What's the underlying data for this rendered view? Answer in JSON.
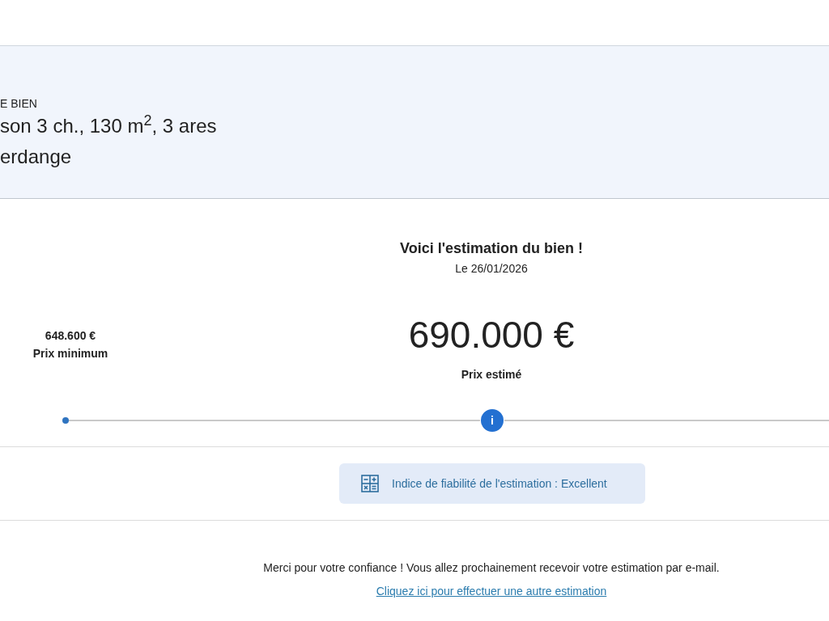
{
  "property": {
    "label": "E BIEN",
    "description": "son 3 ch., 130 m$^{2}$, 3 ares",
    "location": "erdange"
  },
  "estimate": {
    "title": "Voici l'estimation du bien !",
    "date": "Le 26/01/2026",
    "price": "690.000 €",
    "price_label": "Prix estimé",
    "min_price": "648.600 €",
    "min_label": "Prix minimum",
    "info_symbol": "i"
  },
  "reliability": {
    "text": "Indice de fiabilité de l'estimation : Excellent"
  },
  "footer": {
    "message": "Merci pour votre confiance ! Vous allez prochainement recevoir votre estimation par e-mail.",
    "link": "Cliquez ici pour effectuer une autre estimation"
  }
}
